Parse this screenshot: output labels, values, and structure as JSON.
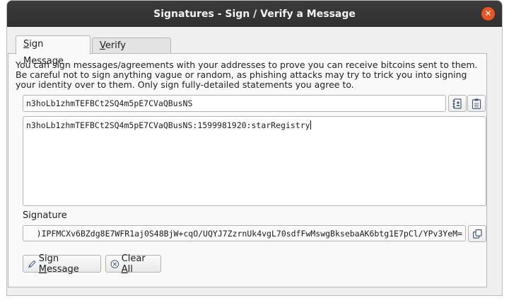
{
  "window": {
    "title": "Signatures - Sign / Verify a Message"
  },
  "tabs": [
    {
      "label_pre": "",
      "label_ul": "S",
      "label_post": "ign Message",
      "active": true
    },
    {
      "label_pre": "",
      "label_ul": "V",
      "label_post": "erify Message",
      "active": false
    }
  ],
  "sign": {
    "description": "You can sign messages/agreements with your addresses to prove you can receive bitcoins sent to them. Be careful not to sign anything vague or random, as phishing attacks may try to trick you into signing your identity over to them. Only sign fully-detailed statements you agree to.",
    "address_value": "n3hoLb1zhmTEFBCt2SQ4m5pE7CVaQBusNS",
    "message_value": "n3hoLb1zhmTEFBCt2SQ4m5pE7CVaQBusNS:1599981920:starRegistry",
    "signature_label": "Signature",
    "signature_value": ")IPFMCXv6BZdg8E7WFR1aj0S48BjW+cqO/UQYJ7ZzrnUk4vgL70sdfFwMswgBksebaAK6btg1E7pCl/YPv3YeM=",
    "sign_button": {
      "pre": "Sign ",
      "ul": "M",
      "post": "essage"
    },
    "clear_button": {
      "pre": "Clear ",
      "ul": "A",
      "post": "ll"
    }
  },
  "colors": {
    "titlebar": "#303030",
    "close": "#e95420",
    "window_bg": "#efefef"
  }
}
